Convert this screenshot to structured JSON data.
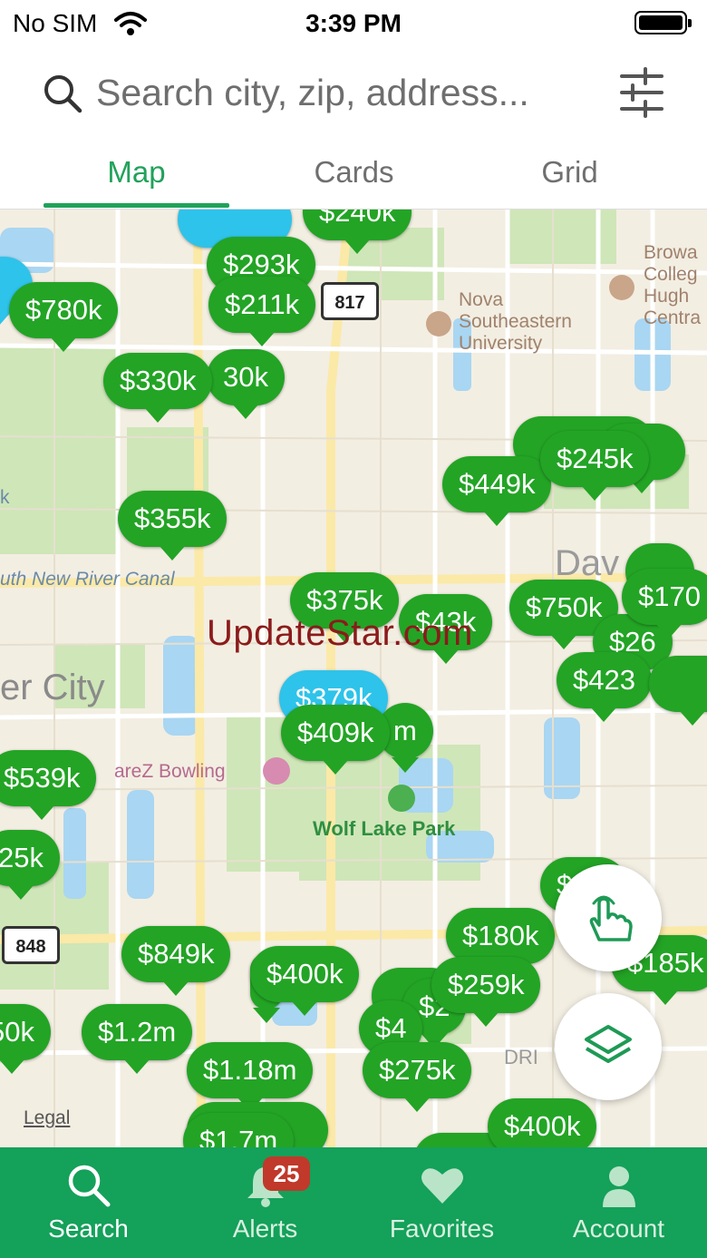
{
  "status_bar": {
    "carrier": "No SIM",
    "time": "3:39 PM"
  },
  "search": {
    "placeholder": "Search city, zip, address..."
  },
  "tabs": [
    {
      "label": "Map"
    },
    {
      "label": "Cards"
    },
    {
      "label": "Grid"
    }
  ],
  "map": {
    "labels": {
      "nova": [
        "Nova",
        "Southeastern",
        "University"
      ],
      "broward": [
        "Browa",
        "Colleg",
        "Hugh",
        "Centra"
      ],
      "canal": "uth New River Canal",
      "city": "er City",
      "bowling": "areZ Bowling",
      "park": "Wolf Lake Park",
      "legal": "Legal",
      "route817": "817",
      "route848": "848",
      "k": "k",
      "drive": "DRI",
      "dav": "Dav"
    },
    "watermark": "UpdateStar.com",
    "pins": [
      "$780k",
      "$211k",
      "$330k",
      "$355k",
      "$449k",
      "$245k",
      "$375k",
      "$43k",
      "$750k",
      "$170",
      "$409k",
      "$539k",
      "25k",
      "$849k",
      "$400k",
      "$180k",
      "$259k",
      "$185k",
      "50k",
      "$1.2m",
      "$1.18m",
      "$400k",
      "$1.7m",
      "$240k",
      "$293k",
      "30k",
      "$379k",
      "m",
      "$26",
      "$423",
      "$4",
      "$2",
      "$",
      "$275k",
      "$249k"
    ]
  },
  "bottom_nav": [
    {
      "label": "Search"
    },
    {
      "label": "Alerts"
    },
    {
      "label": "Favorites"
    },
    {
      "label": "Account"
    }
  ],
  "alerts_badge": "25",
  "colors": {
    "brand_green": "#14a15a",
    "pin_green": "#23a425",
    "pin_blue": "#2ec3ea",
    "badge_red": "#c0392b"
  },
  "icons": [
    "wifi-icon",
    "battery-icon",
    "search-icon",
    "filter-sliders-icon",
    "hand-tap-icon",
    "layers-icon",
    "bell-icon",
    "heart-icon",
    "person-icon"
  ]
}
